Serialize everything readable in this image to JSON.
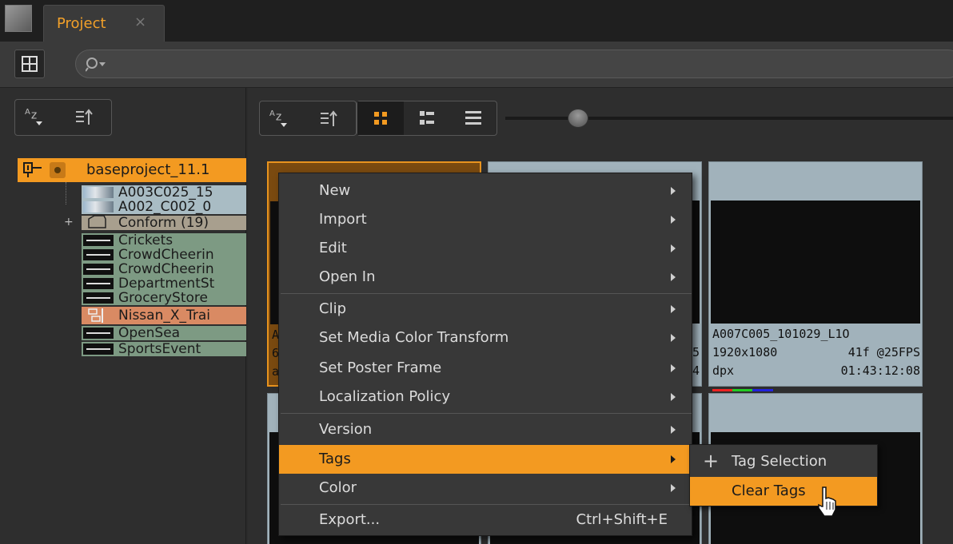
{
  "window": {
    "tab_title": "Project",
    "tab_close": "×"
  },
  "toolbar": {
    "search_placeholder": ""
  },
  "left_panel": {
    "sort_az_label": "A Z",
    "tree": {
      "root_label": "baseproject_11.1",
      "items": [
        {
          "label": "A003C025_15",
          "kind": "clip"
        },
        {
          "label": "A002_C002_0",
          "kind": "clip"
        },
        {
          "label": "Conform (19)",
          "kind": "bin"
        },
        {
          "label": "Crickets",
          "kind": "audio"
        },
        {
          "label": "CrowdCheerin",
          "kind": "audio"
        },
        {
          "label": "CrowdCheerin",
          "kind": "audio"
        },
        {
          "label": "DepartmentSt",
          "kind": "audio"
        },
        {
          "label": "GroceryStore",
          "kind": "audio"
        },
        {
          "label": "Nissan_X_Trai",
          "kind": "sequence"
        },
        {
          "label": "OpenSea",
          "kind": "audio"
        },
        {
          "label": "SportsEvent",
          "kind": "audio"
        }
      ]
    }
  },
  "right_panel": {
    "sort_az_label": "A Z",
    "zoom_slider_value": 0.14,
    "cards": [
      {
        "line1": "A",
        "line2": "6",
        "line3": "a"
      },
      {
        "line1": "",
        "line2": "5",
        "line3": "4"
      },
      {
        "name": "A007C005_101029_L1O",
        "resolution": "1920x1080",
        "frames": "41f @25FPS",
        "format": "dpx",
        "timecode": "01:43:12:08"
      }
    ]
  },
  "context_menu": {
    "items": [
      {
        "label": "New",
        "submenu": true
      },
      {
        "label": "Import",
        "submenu": true
      },
      {
        "label": "Edit",
        "submenu": true
      },
      {
        "label": "Open In",
        "submenu": true
      },
      {
        "label": "Clip",
        "submenu": true
      },
      {
        "label": "Set Media Color Transform",
        "submenu": true
      },
      {
        "label": "Set Poster Frame",
        "submenu": true
      },
      {
        "label": "Localization Policy",
        "submenu": true
      },
      {
        "label": "Version",
        "submenu": true
      },
      {
        "label": "Tags",
        "submenu": true,
        "highlighted": true
      },
      {
        "label": "Color",
        "submenu": true
      },
      {
        "label": "Export...",
        "shortcut": "Ctrl+Shift+E"
      }
    ]
  },
  "tags_submenu": {
    "items": [
      {
        "label": "Tag Selection",
        "icon": "plus-icon"
      },
      {
        "label": "Clear Tags",
        "highlighted": true
      }
    ]
  },
  "colors": {
    "accent": "#f39a21",
    "background": "#2b2b2b",
    "menu_bg": "#383838"
  }
}
